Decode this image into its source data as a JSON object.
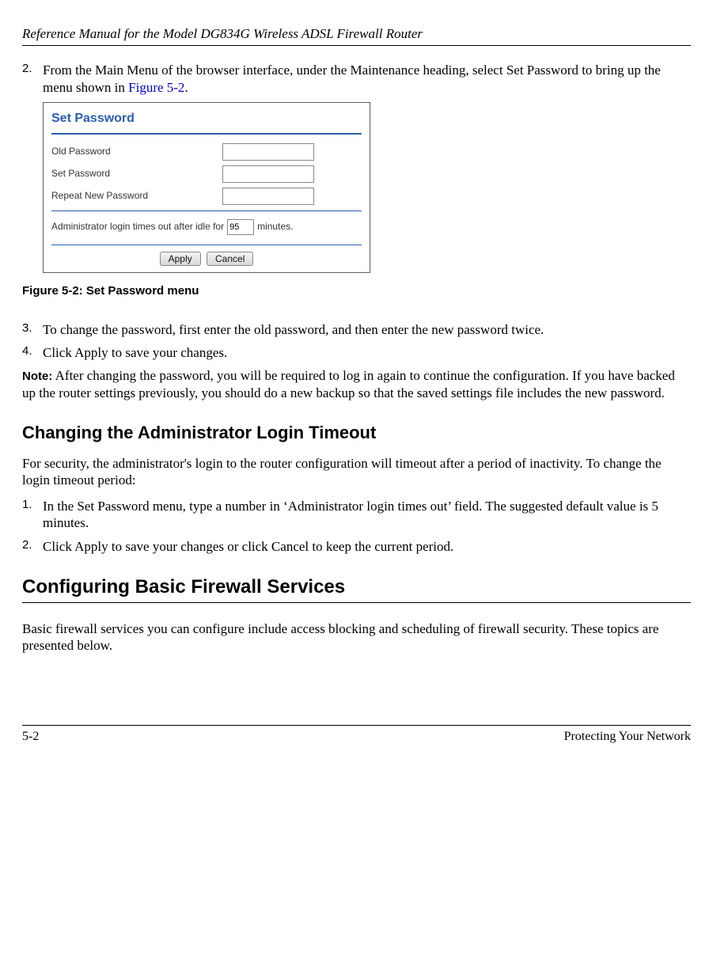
{
  "header": {
    "title": "Reference Manual for the Model DG834G Wireless ADSL Firewall Router"
  },
  "steps_a": {
    "s2": {
      "num": "2.",
      "text_before": "From the Main Menu of the browser interface, under the Maintenance heading, select Set Password to bring up the menu shown in ",
      "link": "Figure 5-2",
      "text_after": "."
    },
    "s3": {
      "num": "3.",
      "text": "To change the password, first enter the old password, and then enter the new password twice."
    },
    "s4": {
      "num": "4.",
      "text": "Click Apply to save your changes."
    }
  },
  "screenshot": {
    "title": "Set Password",
    "rows": {
      "old": "Old Password",
      "set": "Set Password",
      "repeat": "Repeat New Password"
    },
    "timeout_before": "Administrator login times out after idle for",
    "timeout_value": "95",
    "timeout_after": "minutes.",
    "buttons": {
      "apply": "Apply",
      "cancel": "Cancel"
    }
  },
  "figure_caption": "Figure 5-2:  Set Password menu",
  "note": {
    "label": "Note:",
    "text": " After changing the password, you will be required to log in again to continue the configuration. If you have backed up the router settings previously, you should do a new backup so that the saved settings file includes the new password."
  },
  "section_timeout": {
    "heading": "Changing the Administrator Login Timeout",
    "intro": "For security, the administrator's login to the router configuration will timeout after a period of inactivity. To change the login timeout period:",
    "s1": {
      "num": "1.",
      "text": "In the Set Password menu, type a number in ‘Administrator login times out’ field. The suggested default value is 5 minutes."
    },
    "s2": {
      "num": "2.",
      "text": "Click Apply to save your changes or click Cancel to keep the current period."
    }
  },
  "section_firewall": {
    "heading": "Configuring Basic Firewall Services",
    "para": "Basic firewall services you can configure include access blocking and scheduling of firewall security. These topics are presented below."
  },
  "footer": {
    "left": "5-2",
    "right": "Protecting Your Network"
  }
}
